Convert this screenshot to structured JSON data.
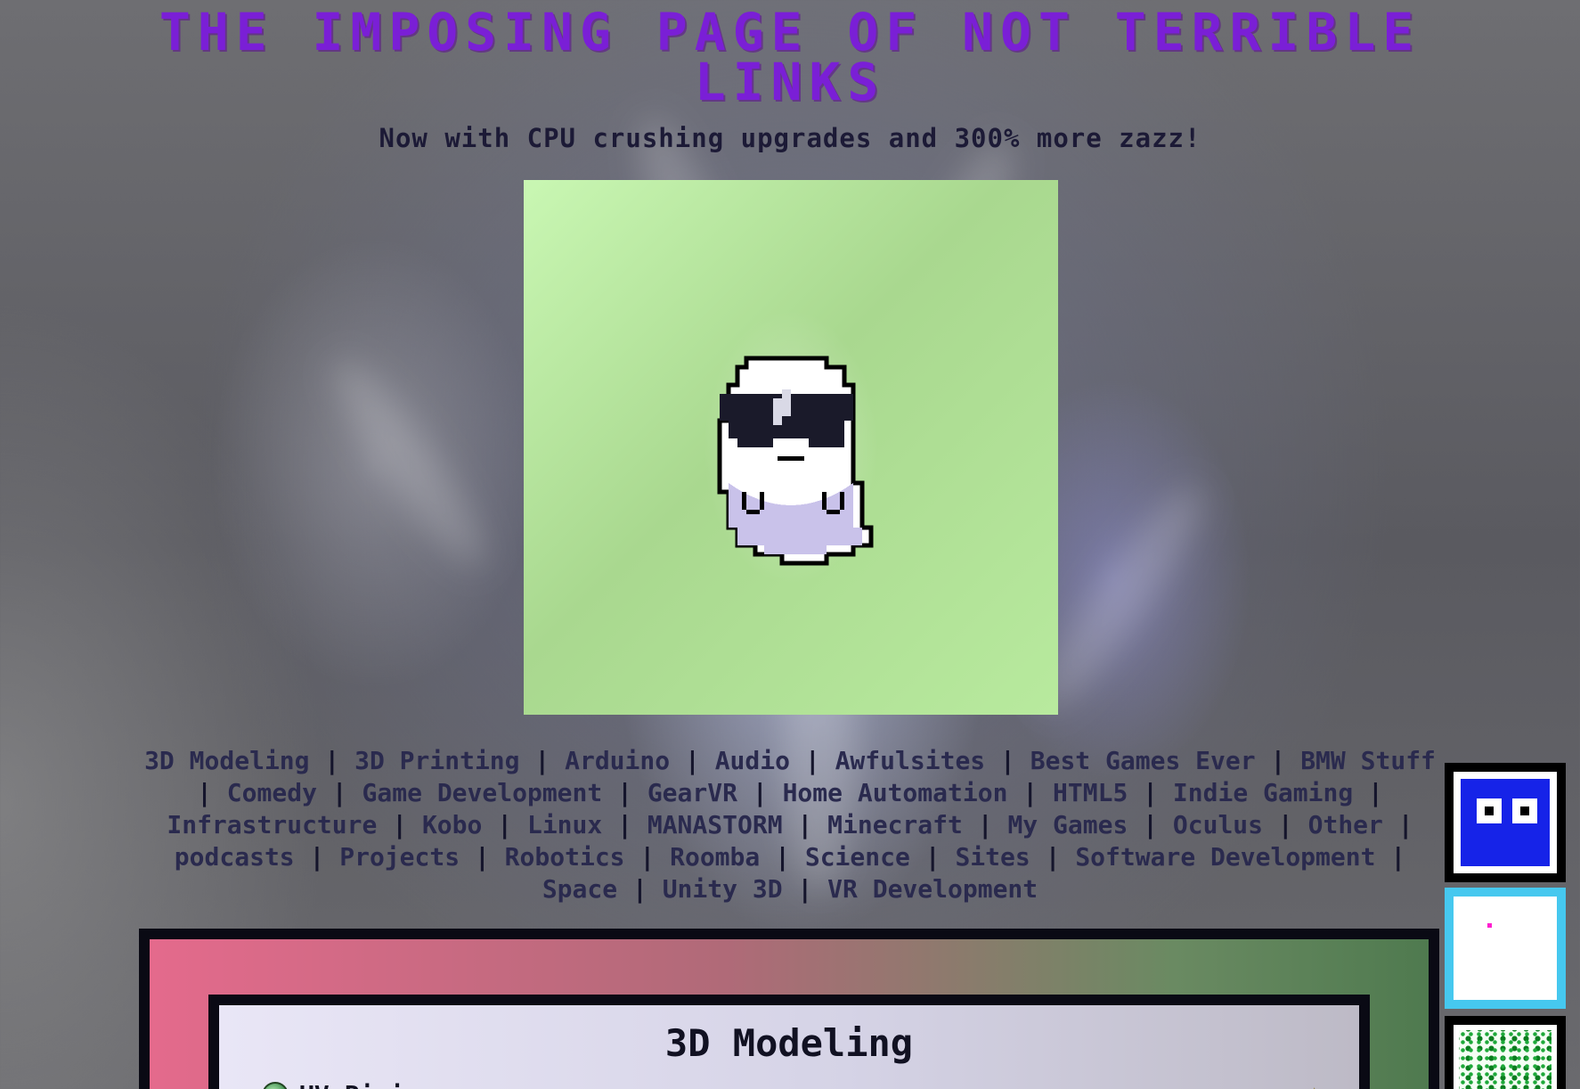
{
  "page": {
    "title": "THE IMPOSING PAGE OF NOT TERRIBLE LINKS",
    "subtitle": "Now with CPU crushing upgrades and 300% more zazz!"
  },
  "nav": {
    "items": [
      "3D Modeling",
      "3D Printing",
      "Arduino",
      "Audio",
      "Awfulsites",
      "Best Games Ever",
      "BMW Stuff",
      "Comedy",
      "Game Development",
      "GearVR",
      "Home Automation",
      "HTML5",
      "Indie Gaming",
      "Infrastructure",
      "Kobo",
      "Linux",
      "MANASTORM",
      "Minecraft",
      "My Games",
      "Oculus",
      "Other",
      "podcasts",
      "Projects",
      "Robotics",
      "Roomba",
      "Science",
      "Sites",
      "Software Development",
      "Space",
      "Unity 3D",
      "VR Development"
    ],
    "separator": " | "
  },
  "section": {
    "title": "3D Modeling",
    "first_link": "UV Piping",
    "first_link_icon": "globe-icon",
    "rating_icon": "star-icon"
  },
  "widgets": {
    "widget_1_icon": "blue-face-icon",
    "widget_2_icon": "pink-dot-icon",
    "widget_3_icon": "green-noise-icon"
  },
  "colors": {
    "title": "#7a1fd6",
    "avatar_bg": "#b8ea9e",
    "widget_blue": "#1623e8",
    "widget_cyan_border": "#46c8ef"
  }
}
